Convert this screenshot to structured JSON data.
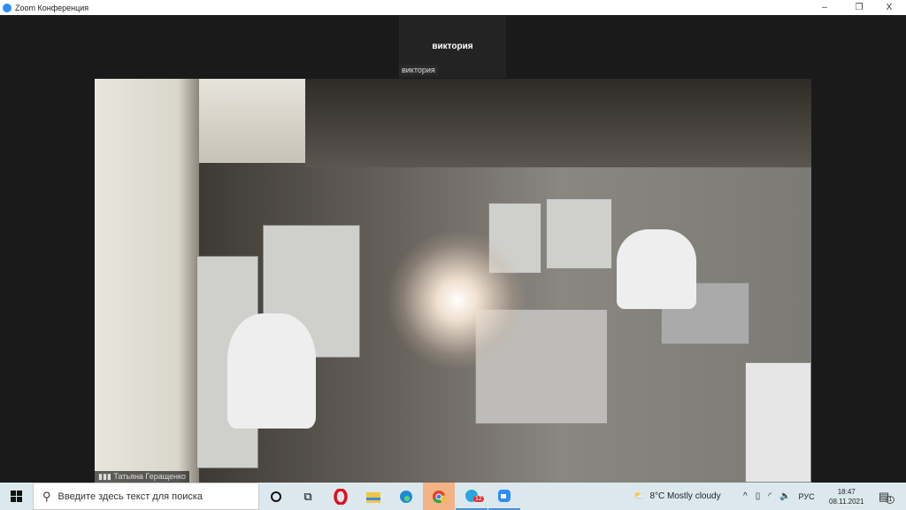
{
  "window": {
    "title": "Zoom Конференция",
    "minimize": "–",
    "restore": "❐",
    "close": "X"
  },
  "participant": {
    "name": "виктория",
    "label": "виктория"
  },
  "share": {
    "presenter": "Татьяна Геращенко"
  },
  "taskbar": {
    "search_placeholder": "Введите здесь текст для поиска",
    "telegram_badge": "12",
    "weather": {
      "temp": "8°C",
      "desc": "Mostly cloudy"
    },
    "lang": "РУС",
    "time": "18:47",
    "date": "08.11.2021",
    "notifications": "1"
  }
}
